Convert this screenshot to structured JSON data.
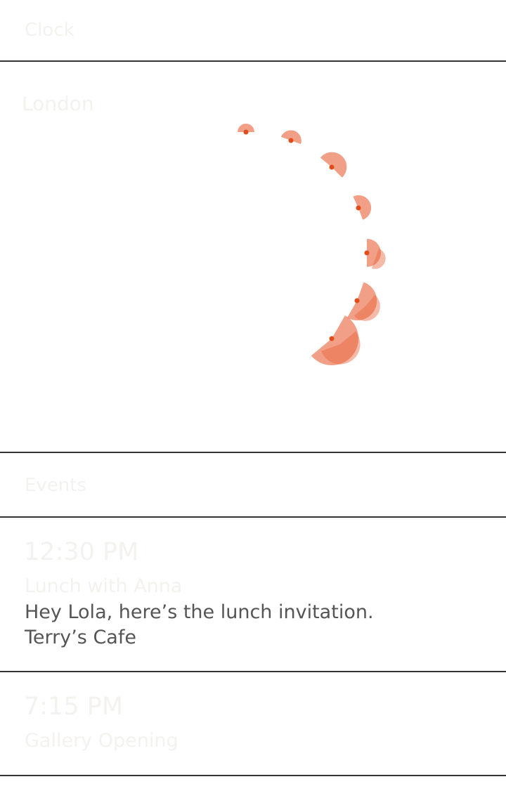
{
  "header": {
    "title": "Clock"
  },
  "clock": {
    "city": "London",
    "accent_color": "#e8643c",
    "dot_color": "#e04d1a"
  },
  "events_section": {
    "title": "Events"
  },
  "events": [
    {
      "time": "12:30 PM",
      "title": "Lunch with Anna",
      "description": "Hey Lola, here’s the lunch invitation.",
      "location": "Terry’s Cafe"
    },
    {
      "time": "7:15 PM",
      "title": "Gallery Opening"
    }
  ]
}
